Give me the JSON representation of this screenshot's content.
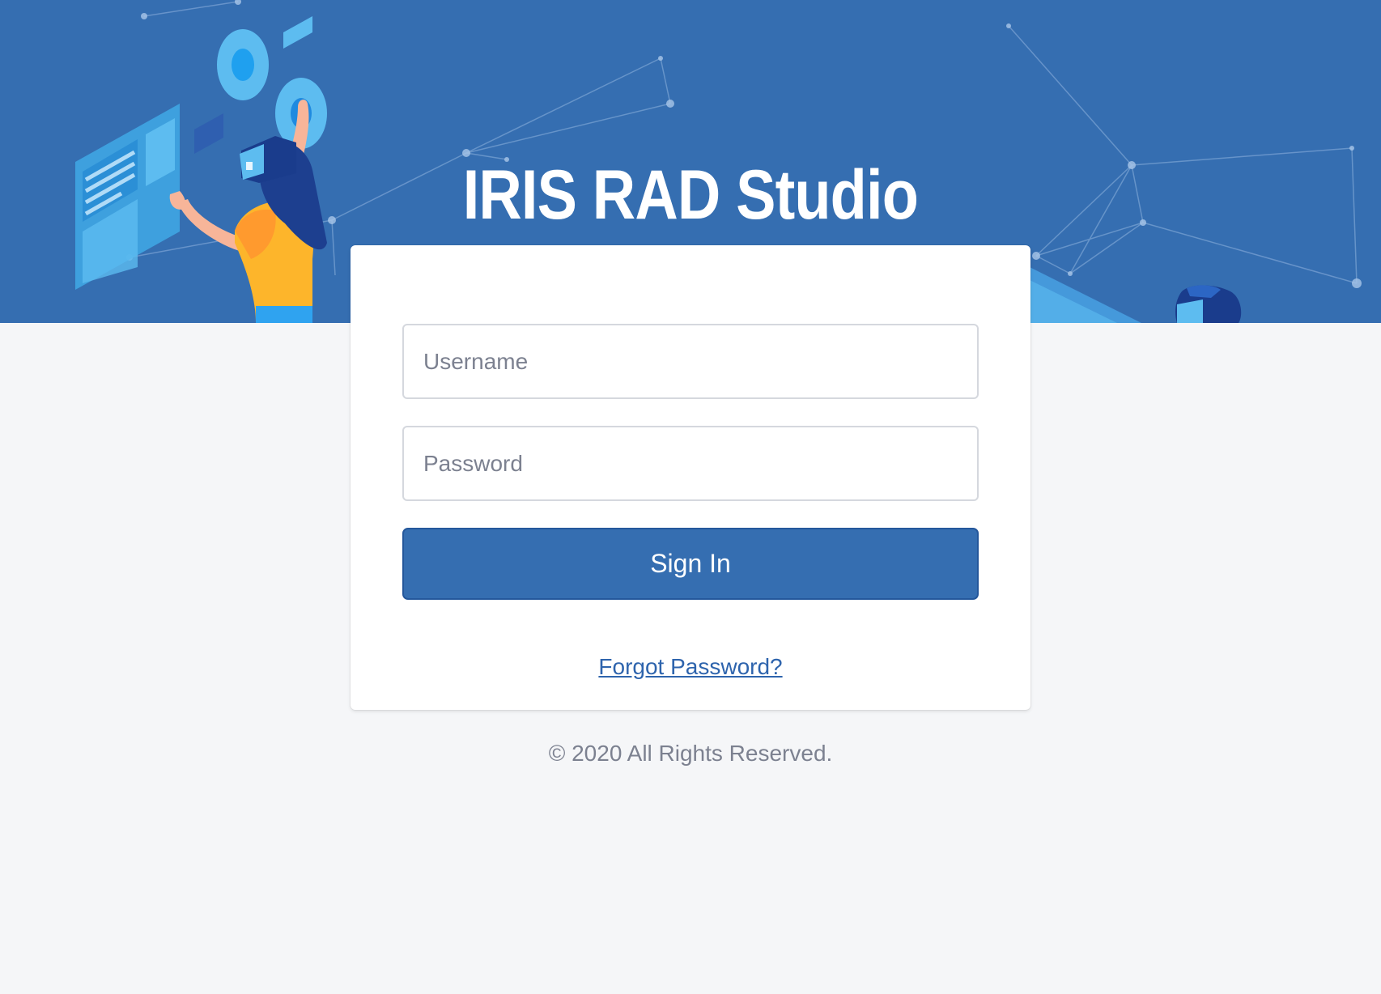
{
  "brand": {
    "title": "IRIS RAD Studio"
  },
  "login": {
    "username_placeholder": "Username",
    "password_placeholder": "Password",
    "signin_label": "Sign In",
    "forgot_label": "Forgot Password?"
  },
  "footer": {
    "copyright": "© 2020 All Rights Reserved."
  },
  "colors": {
    "hero_background": "#356eb1",
    "page_background": "#f5f6f8",
    "button_background": "#356eb1",
    "link": "#2e64ad",
    "muted_text": "#7c8190"
  },
  "illustration": {
    "left": "person-with-vr-headset",
    "right": "vr-headset-and-network"
  }
}
